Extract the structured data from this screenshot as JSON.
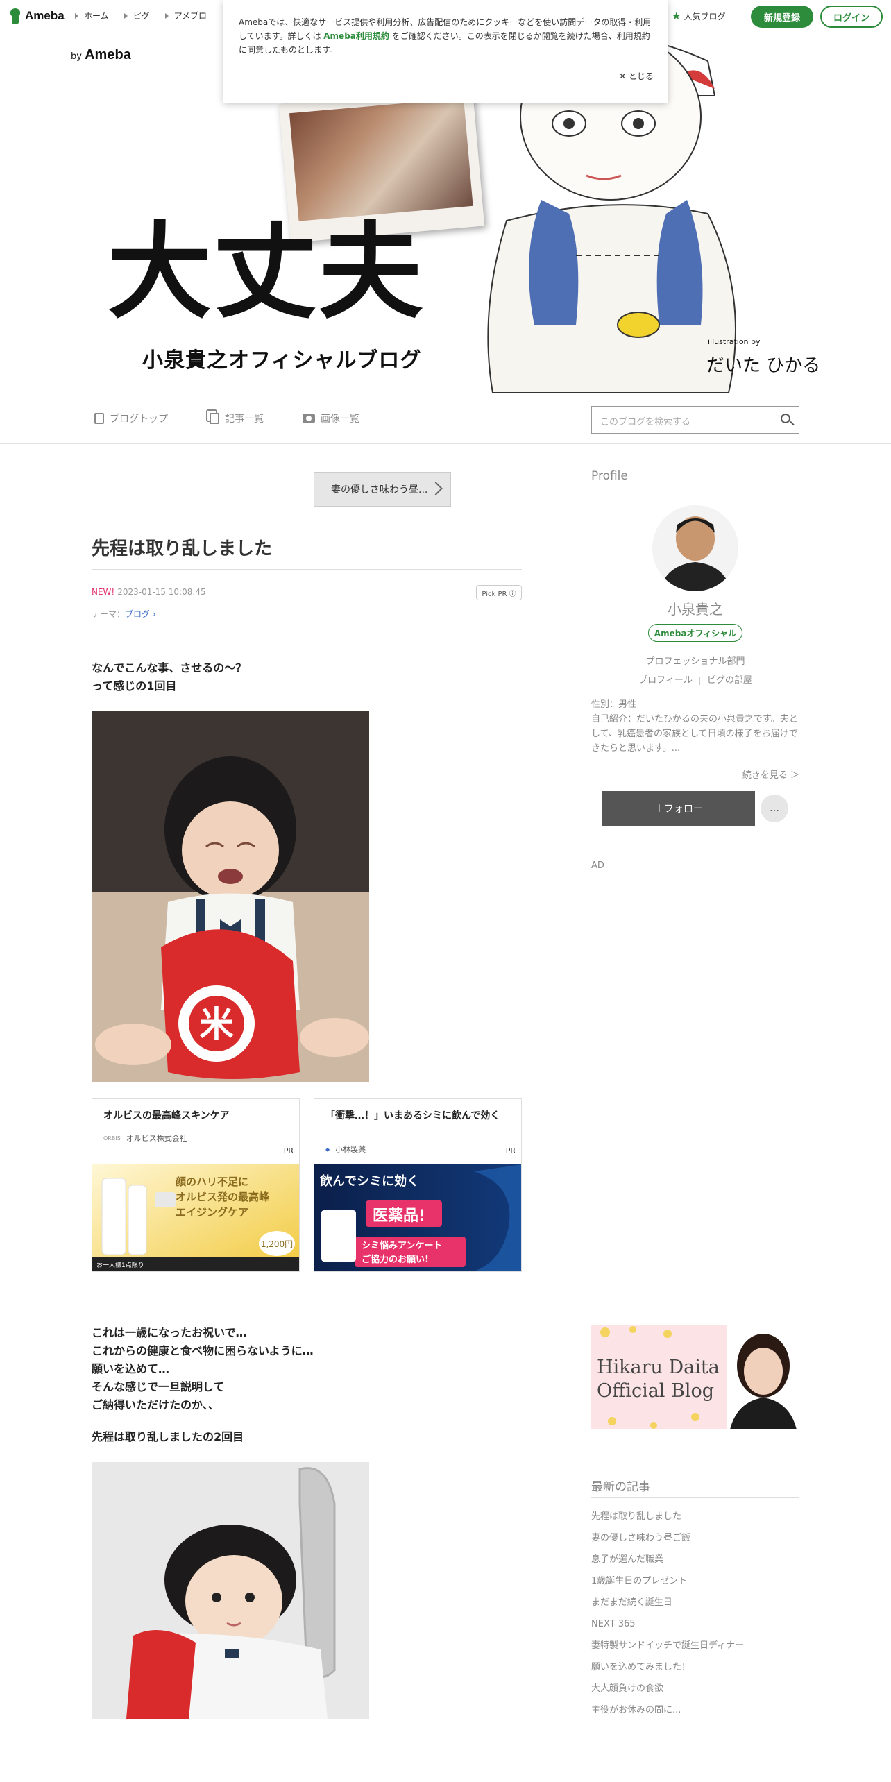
{
  "topbar": {
    "logo": "Ameba",
    "nav": [
      "ホーム",
      "ピグ",
      "アメブロ"
    ],
    "popular": "人気ブログ",
    "register": "新規登録",
    "login": "ログイン"
  },
  "cookie": {
    "text_before": "Amebaでは、快適なサービス提供や利用分析、広告配信のためにクッキーなどを使い訪問データの取得・利用しています。詳しくは ",
    "link": "Ameba利用規約",
    "text_after": " をご確認ください。この表示を閉じるか閲覧を続けた場合、利用規約に同意したものとします。",
    "close": "とじる"
  },
  "banner": {
    "by": "by",
    "brand": "Ameba",
    "title": "大丈夫",
    "subtitle": "小泉貴之オフィシャルブログ",
    "illustration_by": "illustration by",
    "illustrator": "だいた ひかる"
  },
  "blognav": {
    "top": "ブログトップ",
    "list": "記事一覧",
    "images": "画像一覧",
    "search_placeholder": "このブログを検索する"
  },
  "post": {
    "prev": "妻の優しさ味わう昼...",
    "title": "先程は取り乱しました",
    "new": "NEW!",
    "datetime": "2023-01-15 10:08:45",
    "pickpr": "Pick PR ⓘ",
    "theme_label": "テーマ：",
    "theme": "ブログ",
    "para1": "なんでこんな事、させるの〜？\nって感じの1回目",
    "para2": "これは一歳になったお祝いで…\nこれからの健康と食べ物に困らないように…\n願いを込めて…\nそんな感じで一旦説明して\nご納得いただけたのか、、",
    "para3": "先程は取り乱しましたの2回目"
  },
  "ads": [
    {
      "title": "オルビスの最高峰スキンケア",
      "advertiser": "オルビス株式会社",
      "logo": "ORBIS",
      "pr": "PR",
      "img_lines": [
        "顔のハリ不足に",
        "オルビス発の最高峰",
        "エイジングケア"
      ],
      "img_price": "1,200円",
      "img_foot": "お一人様1点限り"
    },
    {
      "title": "「衝撃…！」いまあるシミに飲んで効く",
      "advertiser": "小林製薬",
      "logo": "小林製薬",
      "pr": "PR",
      "img_lines": [
        "飲んでシミに効く",
        "医薬品!",
        "シミ悩みアンケート",
        "ご協力のお願い!"
      ]
    }
  ],
  "sidebar": {
    "profile_head": "Profile",
    "name": "小泉貴之",
    "official": "Amebaオフィシャル",
    "category": "プロフェッショナル部門",
    "profile_link": "プロフィール",
    "pig_link": "ピグの部屋",
    "gender": "性別：男性",
    "intro": "自己紹介：だいたひかるの夫の小泉貴之です。夫として、乳癌患者の家族として日頃の様子をお届けできたらと思います。...",
    "more": "続きを見る ＞",
    "follow": "＋フォロー",
    "dots": "…",
    "ad": "AD",
    "hikaru_line1": "Hikaru Daita",
    "hikaru_line2": "Official Blog",
    "recent_head": "最新の記事",
    "recent": [
      "先程は取り乱しました",
      "妻の優しさ味わう昼ご飯",
      "息子が選んだ職業",
      "1歳誕生日のプレゼント",
      "まだまだ続く誕生日",
      "NEXT 365",
      "妻特製サンドイッチで誕生日ディナー",
      "願いを込めてみました！",
      "大人顔負けの食欲",
      "主役がお休みの間に..."
    ]
  },
  "colors": {
    "brand_green": "#2d8c3c",
    "new_pink": "#e0346d",
    "theme_blue": "#3b6cc2"
  }
}
